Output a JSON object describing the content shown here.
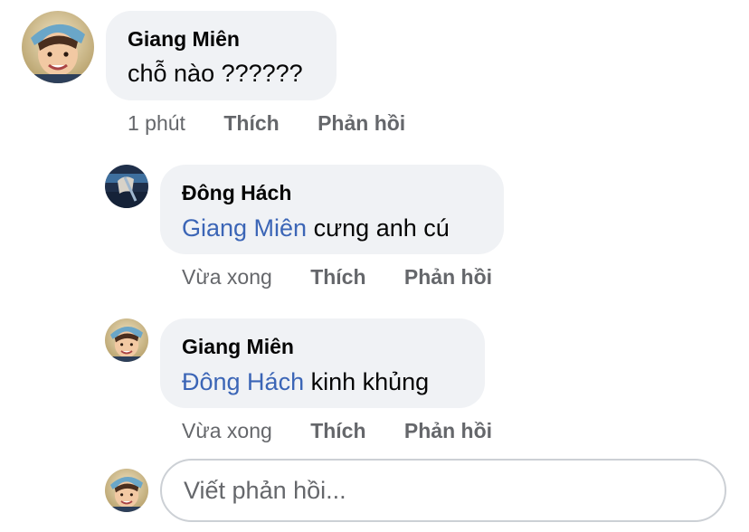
{
  "comments": [
    {
      "author": "Giang Miên",
      "mention": "",
      "text": "chỗ nào ??????",
      "time": "1 phút",
      "like_label": "Thích",
      "reply_label": "Phản hồi"
    },
    {
      "author": "Đông Hách",
      "mention": "Giang Miên",
      "text": " cưng anh cú",
      "time": "Vừa xong",
      "like_label": "Thích",
      "reply_label": "Phản hồi"
    },
    {
      "author": "Giang Miên",
      "mention": "Đông Hách",
      "text": " kinh khủng",
      "time": "Vừa xong",
      "like_label": "Thích",
      "reply_label": "Phản hồi"
    }
  ],
  "reply_box": {
    "placeholder": "Viết phản hồi..."
  },
  "colors": {
    "bubble": "#f0f2f5",
    "mention": "#3b65b6",
    "meta": "#65676b"
  }
}
